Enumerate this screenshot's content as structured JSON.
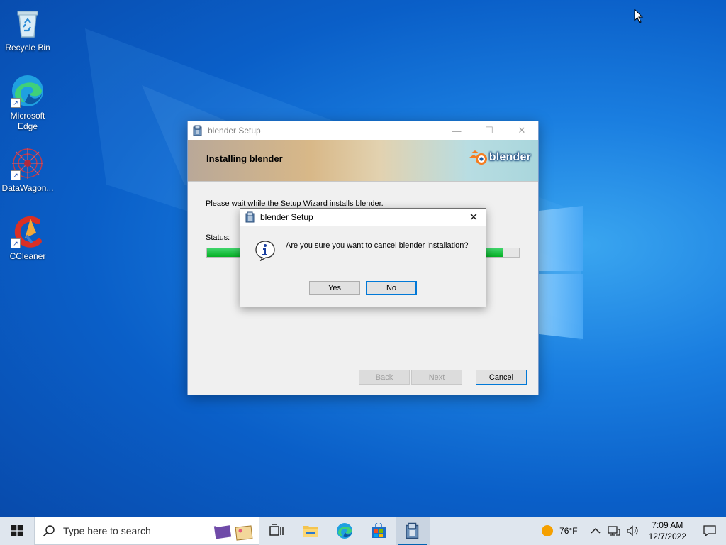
{
  "desktop": {
    "icons": [
      {
        "label": "Recycle Bin",
        "icon": "recycle-bin-icon"
      },
      {
        "label": "Microsoft\nEdge",
        "icon": "edge-icon"
      },
      {
        "label": "DataWagon...",
        "icon": "datawagon-icon"
      },
      {
        "label": "CCleaner",
        "icon": "ccleaner-icon"
      }
    ]
  },
  "setup_window": {
    "title": "blender Setup",
    "banner_title": "Installing blender",
    "logo_text": "blender",
    "wait_text": "Please wait while the Setup Wizard installs blender.",
    "status_label": "Status:",
    "progress": 0.95,
    "back_label": "Back",
    "next_label": "Next",
    "cancel_label": "Cancel"
  },
  "dialog": {
    "title": "blender Setup",
    "message": "Are you sure you want to cancel blender installation?",
    "yes_label": "Yes",
    "no_label": "No",
    "close_glyph": "✕"
  },
  "taskbar": {
    "search_placeholder": "Type here to search",
    "pinned": [
      "task-view-icon",
      "file-explorer-icon",
      "edge-icon",
      "store-icon",
      "blender-setup-icon"
    ],
    "weather_temp": "76°F",
    "time": "7:09 AM",
    "date": "12/7/2022"
  },
  "colors": {
    "accent": "#0078d7",
    "progress": "#06b025"
  }
}
